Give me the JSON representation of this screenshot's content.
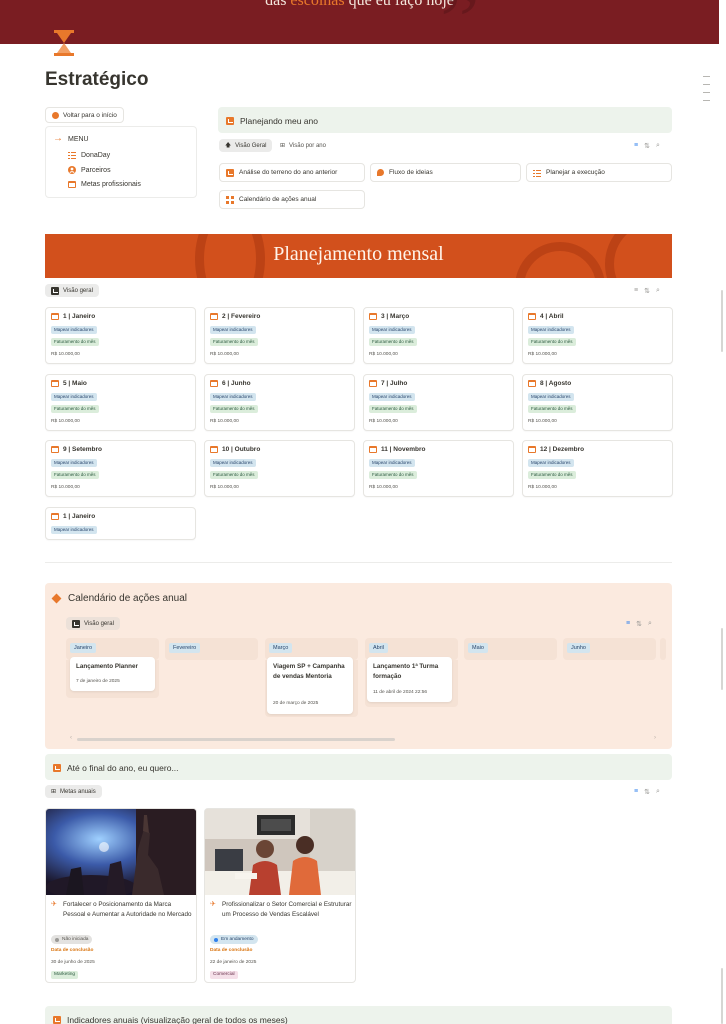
{
  "cover": {
    "quote_plain": "das ",
    "quote_highlight": "escolhas",
    "quote_rest": " que eu faço hoje",
    "mark": "”"
  },
  "page": {
    "title": "Estratégico",
    "icon": "hourglass-icon"
  },
  "nav": {
    "back_label": "Voltar para o início",
    "menu_label": "MENU",
    "items": [
      {
        "label": "DonaDay",
        "icon": "list-icon"
      },
      {
        "label": "Parceiros",
        "icon": "person-icon"
      },
      {
        "label": "Metas profissionais",
        "icon": "calendar-icon"
      }
    ]
  },
  "plan": {
    "title": "Planejando meu ano",
    "tabs": [
      {
        "label": "Visão Geral",
        "icon": "arrow-up-icon"
      },
      {
        "label": "Visão por ano",
        "icon": "table-icon"
      }
    ],
    "links": [
      {
        "label": "Análise do terreno do ano anterior",
        "icon": "archive-icon"
      },
      {
        "label": "Fluxo de ideias",
        "icon": "chat-icon"
      },
      {
        "label": "Planejar a execução",
        "icon": "list-icon"
      },
      {
        "label": "Calendário de ações anual",
        "icon": "grid-icon"
      }
    ]
  },
  "monthly": {
    "banner": "Planejamento mensal",
    "view_label": "Visão geral",
    "tag_indicators": "Mapear indicadores",
    "tag_revenue": "Faturamento do mês",
    "months": [
      {
        "label": "1 | Janeiro",
        "value": "R$ 10.000,00"
      },
      {
        "label": "2 | Fevereiro",
        "value": "R$ 10.000,00"
      },
      {
        "label": "3 | Março",
        "value": "R$ 10.000,00"
      },
      {
        "label": "4 | Abril",
        "value": "R$ 10.000,00"
      },
      {
        "label": "5 | Maio",
        "value": "R$ 10.000,00"
      },
      {
        "label": "6 | Junho",
        "value": "R$ 10.000,00"
      },
      {
        "label": "7 | Julho",
        "value": "R$ 10.000,00"
      },
      {
        "label": "8 | Agosto",
        "value": "R$ 10.000,00"
      },
      {
        "label": "9 | Setembro",
        "value": "R$ 10.000,00"
      },
      {
        "label": "10 | Outubro",
        "value": "R$ 10.000,00"
      },
      {
        "label": "11 | Novembro",
        "value": "R$ 10.000,00"
      },
      {
        "label": "12 | Dezembro",
        "value": "R$ 10.000,00"
      },
      {
        "label": "1 | Janeiro",
        "value": ""
      }
    ]
  },
  "calendar": {
    "title": "Calendário de ações anual",
    "view_label": "Visão geral",
    "columns": [
      "Janeiro",
      "Fevereiro",
      "Março",
      "Abril",
      "Maio",
      "Junho"
    ],
    "events": [
      {
        "title": "Lançamento Planner",
        "date": "7 de janeiro de 2025"
      },
      {
        "title": "Viagem SP + Campanha de vendas Mentoria",
        "date": "20 de março de 2025"
      },
      {
        "title": "Lançamento 1ª Turma formação",
        "date": "11 de abril de 2024 22:56"
      }
    ]
  },
  "goals": {
    "callout_title": "Até o final do ano, eu quero...",
    "view_label": "Metas anuais",
    "cards": [
      {
        "title": "Fortalecer o Posicionamento da Marca Pessoal e Aumentar a Autoridade no Mercado",
        "status": "Não iniciada",
        "status_color": "#9b9a97",
        "date_label": "Data de conclusão",
        "date": "30 de junho de 2025",
        "tag": "Marketing",
        "tag_bg": "#dbeddb",
        "tag_fg": "#2b593f"
      },
      {
        "title": "Profissionalizar o Setor Comercial e Estruturar um Processo de Vendas Escalável",
        "status": "Em andamento",
        "status_color": "#2f80ed",
        "date_label": "Data de conclusão",
        "date": "22 de janeiro de 2025",
        "tag": "Comercial",
        "tag_bg": "#f5e0e9",
        "tag_fg": "#69314c"
      }
    ]
  },
  "indicators": {
    "title": "Indicadores anuais (visualização geral de todos os meses)"
  },
  "colors": {
    "accent": "#e8782b",
    "cover": "#7a1d22",
    "banner": "#d2501c",
    "callout": "#edf3ec",
    "calendar_bg": "#fbeadf"
  }
}
